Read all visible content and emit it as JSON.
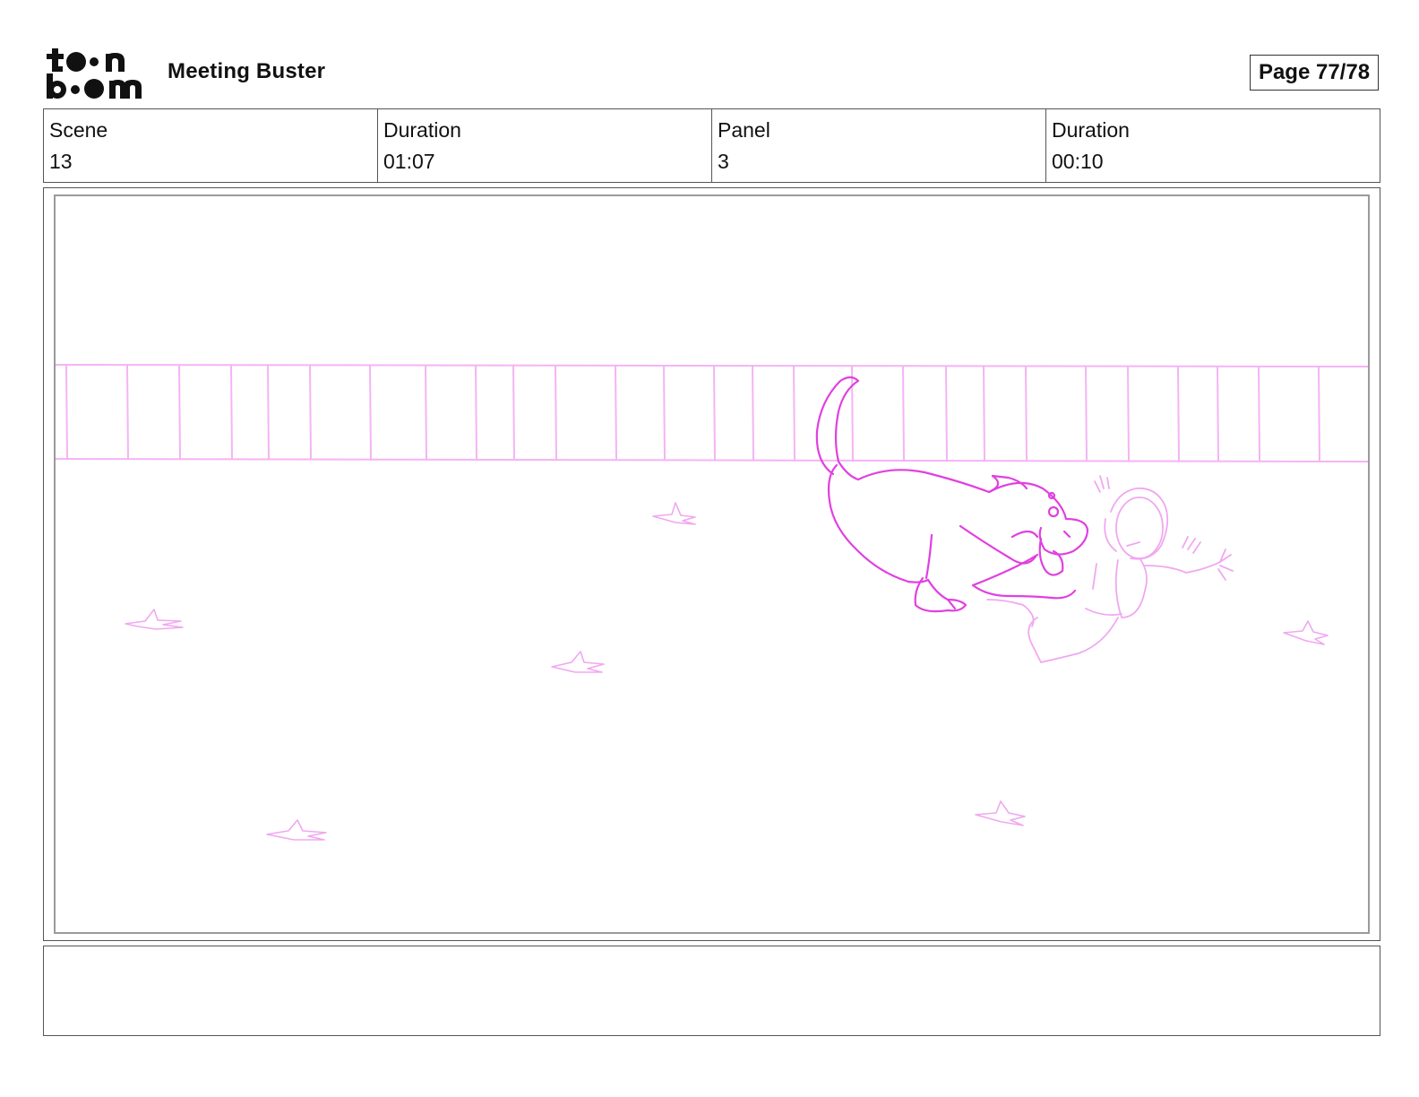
{
  "header": {
    "logo_text_top": "toon",
    "logo_text_bottom": "boom",
    "project_title": "Meeting Buster",
    "page_label": "Page 77/78"
  },
  "info": [
    {
      "label": "Scene",
      "value": "13"
    },
    {
      "label": "Duration",
      "value": "01:07"
    },
    {
      "label": "Panel",
      "value": "3"
    },
    {
      "label": "Duration",
      "value": "00:10"
    }
  ],
  "panel": {
    "sketch_color": "#e040e0",
    "sketch_light_color": "#f0a8f0"
  },
  "notes": {
    "text": ""
  }
}
